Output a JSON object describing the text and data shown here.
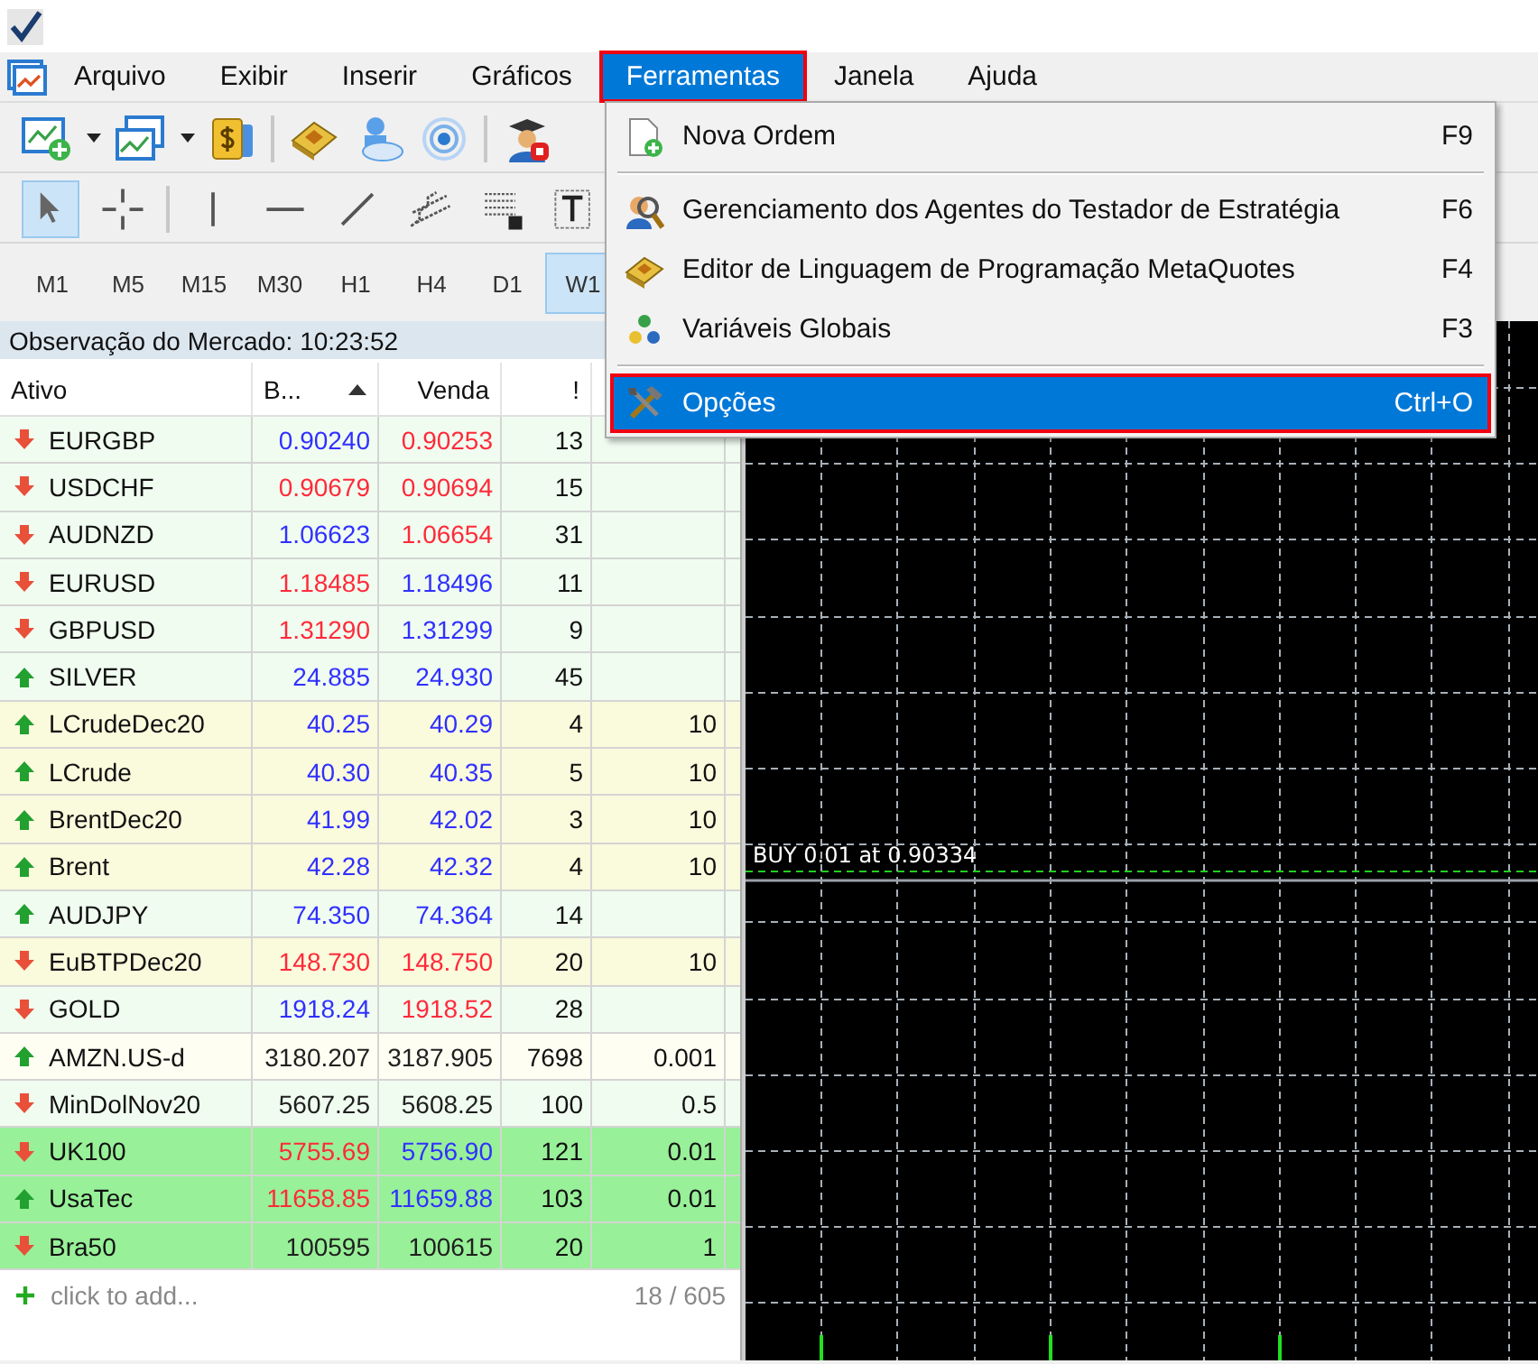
{
  "menu_bar": [
    {
      "label": "Arquivo",
      "selected": false,
      "annotated": false
    },
    {
      "label": "Exibir",
      "selected": false,
      "annotated": false
    },
    {
      "label": "Inserir",
      "selected": false,
      "annotated": false
    },
    {
      "label": "Gráficos",
      "selected": false,
      "annotated": false
    },
    {
      "label": "Ferramentas",
      "selected": true,
      "annotated": true
    },
    {
      "label": "Janela",
      "selected": false,
      "annotated": false
    },
    {
      "label": "Ajuda",
      "selected": false,
      "annotated": false
    }
  ],
  "drawing_tools": [
    {
      "selected": true
    },
    {
      "selected": false
    },
    {
      "selected": false
    },
    {
      "selected": false
    },
    {
      "selected": false
    },
    {
      "selected": false
    },
    {
      "selected": false
    },
    {
      "selected": false
    }
  ],
  "timeframes": [
    {
      "label": "M1",
      "selected": false
    },
    {
      "label": "M5",
      "selected": false
    },
    {
      "label": "M15",
      "selected": false
    },
    {
      "label": "M30",
      "selected": false
    },
    {
      "label": "H1",
      "selected": false
    },
    {
      "label": "H4",
      "selected": false
    },
    {
      "label": "D1",
      "selected": false
    },
    {
      "label": "W1",
      "selected": true
    }
  ],
  "dropdown_menu": {
    "groups": [
      [
        {
          "label": "Nova Ordem",
          "shortcut": "F9",
          "selected": false,
          "annotated": false
        }
      ],
      [
        {
          "label": "Gerenciamento dos Agentes do Testador de Estratégia",
          "shortcut": "F6",
          "selected": false,
          "annotated": false
        },
        {
          "label": "Editor de Linguagem de Programação MetaQuotes",
          "shortcut": "F4",
          "selected": false,
          "annotated": false
        },
        {
          "label": "Variáveis Globais",
          "shortcut": "F3",
          "selected": false,
          "annotated": false
        }
      ],
      [
        {
          "label": "Opções",
          "shortcut": "Ctrl+O",
          "selected": true,
          "annotated": true
        }
      ]
    ]
  },
  "market_watch": {
    "title": "Observação do Mercado: 10:23:52",
    "columns": [
      {
        "label": "Ativo",
        "sorted": false
      },
      {
        "label": "B...",
        "sorted": true
      },
      {
        "label": "Venda",
        "sorted": false
      },
      {
        "label": "!",
        "sorted": false
      }
    ],
    "rows": [
      {
        "symbol": "EURGBP",
        "kind": "down",
        "color": "#f0fcf0",
        "bid": {
          "text": "0.90240",
          "color": "#3030ff"
        },
        "ask": {
          "text": "0.90253",
          "color": "#ff2a3a"
        },
        "spread": "13"
      },
      {
        "symbol": "USDCHF",
        "kind": "down",
        "color": "#f0fcf0",
        "bid": {
          "text": "0.90679",
          "color": "#ff2a3a"
        },
        "ask": {
          "text": "0.90694",
          "color": "#ff2a3a"
        },
        "spread": "15"
      },
      {
        "symbol": "AUDNZD",
        "kind": "down",
        "color": "#f0fcf0",
        "bid": {
          "text": "1.06623",
          "color": "#3030ff"
        },
        "ask": {
          "text": "1.06654",
          "color": "#ff2a3a"
        },
        "spread": "31"
      },
      {
        "symbol": "EURUSD",
        "kind": "down",
        "color": "#f0fcf0",
        "bid": {
          "text": "1.18485",
          "color": "#ff2a3a"
        },
        "ask": {
          "text": "1.18496",
          "color": "#3030ff"
        },
        "spread": "11"
      },
      {
        "symbol": "GBPUSD",
        "kind": "down",
        "color": "#f0fcf0",
        "bid": {
          "text": "1.31290",
          "color": "#ff2a3a"
        },
        "ask": {
          "text": "1.31299",
          "color": "#3030ff"
        },
        "spread": "9"
      },
      {
        "symbol": "SILVER",
        "kind": "up",
        "color": "#f0fcf0",
        "bid": {
          "text": "24.885",
          "color": "#3030ff"
        },
        "ask": {
          "text": "24.930",
          "color": "#3030ff"
        },
        "spread": "45"
      },
      {
        "symbol": "LCrudeDec20",
        "kind": "up",
        "color": "#fafadc",
        "bid": {
          "text": "40.25",
          "color": "#3030ff"
        },
        "ask": {
          "text": "40.29",
          "color": "#3030ff"
        },
        "spread": "4",
        "column_5": "10"
      },
      {
        "symbol": "LCrude",
        "kind": "up",
        "color": "#fafadc",
        "bid": {
          "text": "40.30",
          "color": "#3030ff"
        },
        "ask": {
          "text": "40.35",
          "color": "#3030ff"
        },
        "spread": "5",
        "column_5": "10"
      },
      {
        "symbol": "BrentDec20",
        "kind": "up",
        "color": "#fafadc",
        "bid": {
          "text": "41.99",
          "color": "#3030ff"
        },
        "ask": {
          "text": "42.02",
          "color": "#3030ff"
        },
        "spread": "3",
        "column_5": "10"
      },
      {
        "symbol": "Brent",
        "kind": "up",
        "color": "#fafadc",
        "bid": {
          "text": "42.28",
          "color": "#3030ff"
        },
        "ask": {
          "text": "42.32",
          "color": "#3030ff"
        },
        "spread": "4",
        "column_5": "10"
      },
      {
        "symbol": "AUDJPY",
        "kind": "up",
        "color": "#f0fcf0",
        "bid": {
          "text": "74.350",
          "color": "#3030ff"
        },
        "ask": {
          "text": "74.364",
          "color": "#3030ff"
        },
        "spread": "14"
      },
      {
        "symbol": "EuBTPDec20",
        "kind": "down",
        "color": "#fafadc",
        "bid": {
          "text": "148.730",
          "color": "#ff2a3a"
        },
        "ask": {
          "text": "148.750",
          "color": "#ff2a3a"
        },
        "spread": "20",
        "column_5": "10"
      },
      {
        "symbol": "GOLD",
        "kind": "down",
        "color": "#f0fcf0",
        "bid": {
          "text": "1918.24",
          "color": "#3030ff"
        },
        "ask": {
          "text": "1918.52",
          "color": "#ff2a3a"
        },
        "spread": "28"
      },
      {
        "symbol": "AMZN.US-d",
        "kind": "up",
        "color": "#fefef2",
        "bid": {
          "text": "3180.207",
          "color": "#202020"
        },
        "ask": {
          "text": "3187.905",
          "color": "#202020"
        },
        "spread": "7698",
        "column_5": "0.001"
      },
      {
        "symbol": "MinDolNov20",
        "kind": "down",
        "color": "#f0fcf0",
        "bid": {
          "text": "5607.25",
          "color": "#202020"
        },
        "ask": {
          "text": "5608.25",
          "color": "#202020"
        },
        "spread": "100",
        "column_5": "0.5"
      },
      {
        "symbol": "UK100",
        "kind": "down",
        "color": "#98f098",
        "bid": {
          "text": "5755.69",
          "color": "#ff2a3a"
        },
        "ask": {
          "text": "5756.90",
          "color": "#3030ff"
        },
        "spread": "121",
        "column_5": "0.01"
      },
      {
        "symbol": "UsaTec",
        "kind": "up",
        "color": "#98f098",
        "bid": {
          "text": "11658.85",
          "color": "#ff2a3a"
        },
        "ask": {
          "text": "11659.88",
          "color": "#3030ff"
        },
        "spread": "103",
        "column_5": "0.01"
      },
      {
        "symbol": "Bra50",
        "kind": "down",
        "color": "#98f098",
        "bid": {
          "text": "100595",
          "color": "#202020"
        },
        "ask": {
          "text": "100615",
          "color": "#202020"
        },
        "spread": "20",
        "column_5": "1"
      }
    ],
    "add_row": {
      "label": "click to add...",
      "count": "18 / 605"
    }
  },
  "chart": {
    "order_label": "BUY 0.01 at 0.90334"
  }
}
